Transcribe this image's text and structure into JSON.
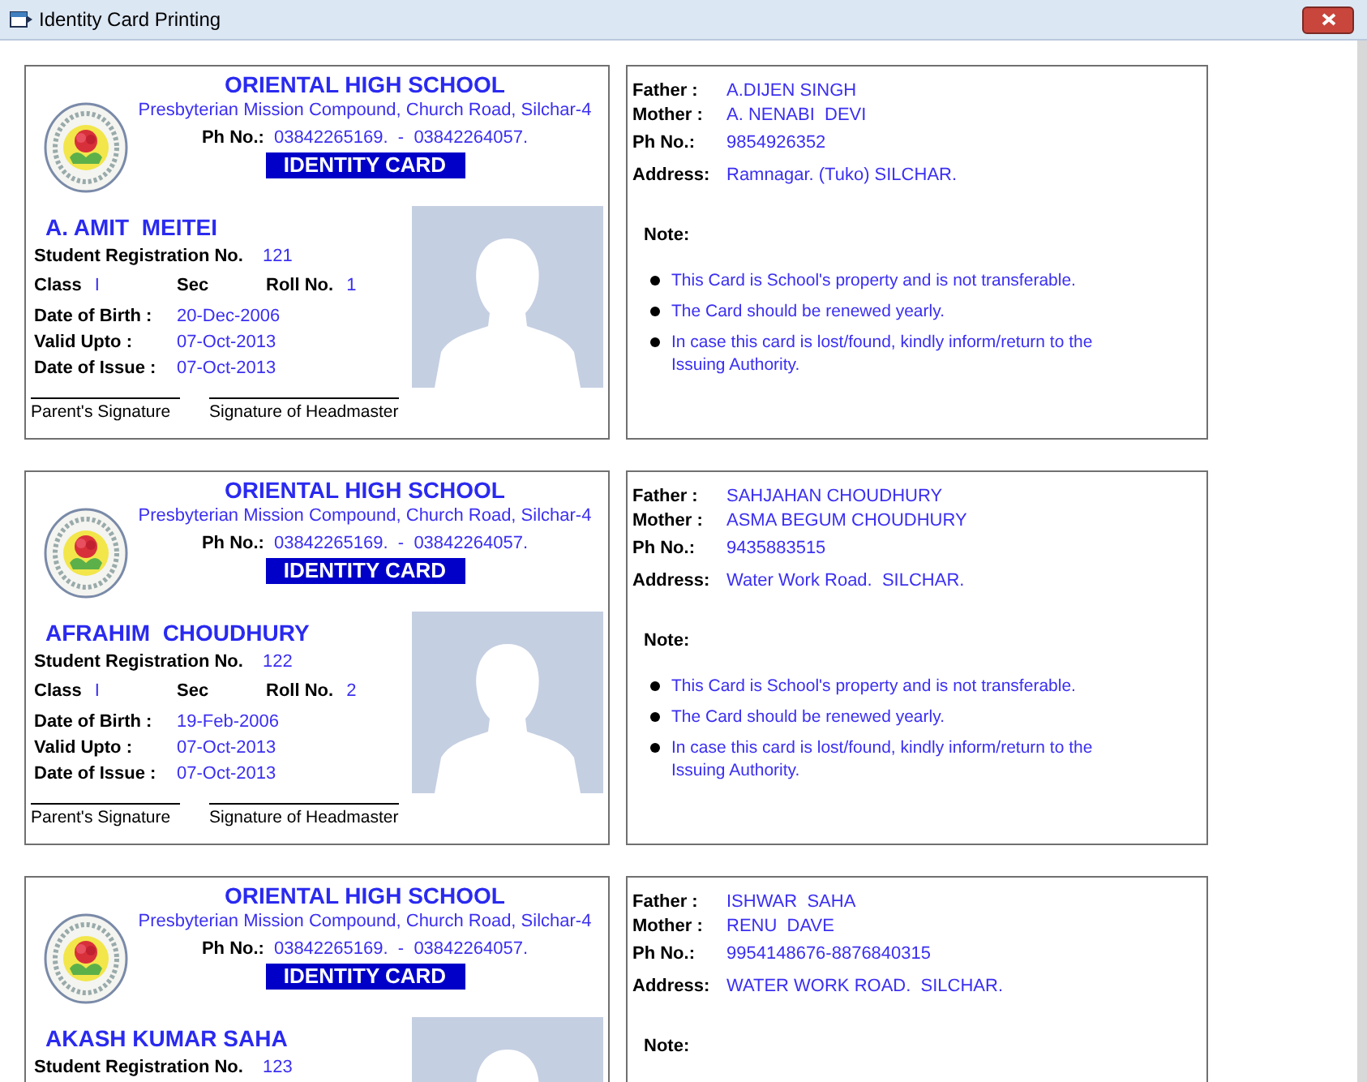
{
  "window": {
    "title": "Identity Card Printing"
  },
  "cards": [
    {
      "front": {
        "school": "ORIENTAL HIGH SCHOOL",
        "address": "Presbyterian Mission Compound, Church Road, Silchar-4",
        "phone_label": "Ph No.:",
        "phone": "03842265169.  -  03842264057.",
        "card_title": "IDENTITY CARD",
        "student_name": "A. AMIT  MEITEI",
        "registration": {
          "label": "Student Registration No.",
          "value": "121"
        },
        "class_row": [
          {
            "label": "Class",
            "value": "I"
          },
          {
            "label": "Sec"
          },
          {
            "label": "Roll No.",
            "value": "1"
          }
        ],
        "dates": [
          {
            "label": "Date of Birth :",
            "value": "20-Dec-2006"
          },
          {
            "label": "Valid Upto :",
            "value": "07-Oct-2013"
          },
          {
            "label": "Date of Issue :",
            "value": "07-Oct-2013"
          }
        ],
        "signatures": [
          "Parent's Signature",
          "Signature of Headmaster"
        ]
      },
      "back": {
        "contacts": [
          {
            "label": "Father :",
            "value": "A.DIJEN SINGH"
          },
          {
            "label": "Mother :",
            "value": "A. NENABI  DEVI"
          },
          {
            "label": "Ph No.:",
            "value": "9854926352"
          },
          {
            "label": "Address:",
            "value": "Ramnagar. (Tuko) SILCHAR."
          }
        ],
        "note_label": "Note:",
        "notes": [
          "This Card is School's property and is not transferable.",
          "The Card should be renewed yearly.",
          "In case this card is lost/found, kindly inform/return to the Issuing Authority."
        ]
      }
    },
    {
      "front": {
        "school": "ORIENTAL HIGH SCHOOL",
        "address": "Presbyterian Mission Compound, Church Road, Silchar-4",
        "phone_label": "Ph No.:",
        "phone": "03842265169.  -  03842264057.",
        "card_title": "IDENTITY CARD",
        "student_name": "AFRAHIM  CHOUDHURY",
        "registration": {
          "label": "Student Registration No.",
          "value": "122"
        },
        "class_row": [
          {
            "label": "Class",
            "value": "I"
          },
          {
            "label": "Sec"
          },
          {
            "label": "Roll No.",
            "value": "2"
          }
        ],
        "dates": [
          {
            "label": "Date of Birth :",
            "value": "19-Feb-2006"
          },
          {
            "label": "Valid Upto :",
            "value": "07-Oct-2013"
          },
          {
            "label": "Date of Issue :",
            "value": "07-Oct-2013"
          }
        ],
        "signatures": [
          "Parent's Signature",
          "Signature of Headmaster"
        ]
      },
      "back": {
        "contacts": [
          {
            "label": "Father :",
            "value": "SAHJAHAN CHOUDHURY"
          },
          {
            "label": "Mother :",
            "value": "ASMA BEGUM CHOUDHURY"
          },
          {
            "label": "Ph No.:",
            "value": "9435883515"
          },
          {
            "label": "Address:",
            "value": "Water Work Road.  SILCHAR."
          }
        ],
        "note_label": "Note:",
        "notes": [
          "This Card is School's property and is not transferable.",
          "The Card should be renewed yearly.",
          "In case this card is lost/found, kindly inform/return to the Issuing Authority."
        ]
      }
    },
    {
      "front": {
        "school": "ORIENTAL HIGH SCHOOL",
        "address": "Presbyterian Mission Compound, Church Road, Silchar-4",
        "phone_label": "Ph No.:",
        "phone": "03842265169.  -  03842264057.",
        "card_title": "IDENTITY CARD",
        "student_name": "AKASH KUMAR SAHA",
        "registration": {
          "label": "Student Registration No.",
          "value": "123"
        }
      },
      "back": {
        "contacts": [
          {
            "label": "Father :",
            "value": "ISHWAR  SAHA"
          },
          {
            "label": "Mother :",
            "value": "RENU  DAVE"
          },
          {
            "label": "Ph No.:",
            "value": "9954148676-8876840315"
          },
          {
            "label": "Address:",
            "value": "WATER WORK ROAD.  SILCHAR."
          }
        ],
        "note_label": "Note:"
      }
    }
  ]
}
